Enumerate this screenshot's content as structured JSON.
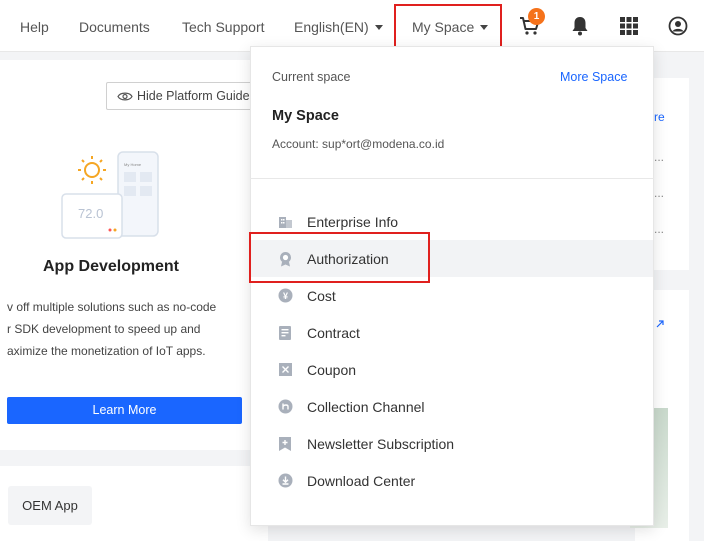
{
  "topnav": {
    "help": "Help",
    "documents": "Documents",
    "tech_support": "Tech Support",
    "language": "English(EN)",
    "my_space": "My Space",
    "cart_badge": "1"
  },
  "left": {
    "hide_guide": "Hide Platform Guide",
    "illus_label": "My Home",
    "illus_temp": "72.0",
    "app_title": "App Development",
    "desc_lines": [
      "v off multiple solutions such as no-code",
      "r SDK development to speed up and",
      "aximize the monetization of IoT apps."
    ],
    "learn_more": "Learn More",
    "oem_app": "OEM App"
  },
  "right": {
    "more_fragment": "re",
    "dots": "..."
  },
  "dropdown": {
    "current_space_label": "Current space",
    "more_space": "More Space",
    "space_name": "My Space",
    "account": "Account: sup*ort@modena.co.id",
    "items": [
      {
        "label": "Enterprise Info",
        "icon": "building-icon"
      },
      {
        "label": "Authorization",
        "icon": "medal-icon"
      },
      {
        "label": "Cost",
        "icon": "coin-icon"
      },
      {
        "label": "Contract",
        "icon": "contract-icon"
      },
      {
        "label": "Coupon",
        "icon": "coupon-icon"
      },
      {
        "label": "Collection Channel",
        "icon": "channel-icon"
      },
      {
        "label": "Newsletter Subscription",
        "icon": "newsletter-icon"
      },
      {
        "label": "Download Center",
        "icon": "download-icon"
      }
    ]
  },
  "colors": {
    "accent": "#1a66ff",
    "highlight": "#e0201e",
    "badge": "#f5721b"
  }
}
